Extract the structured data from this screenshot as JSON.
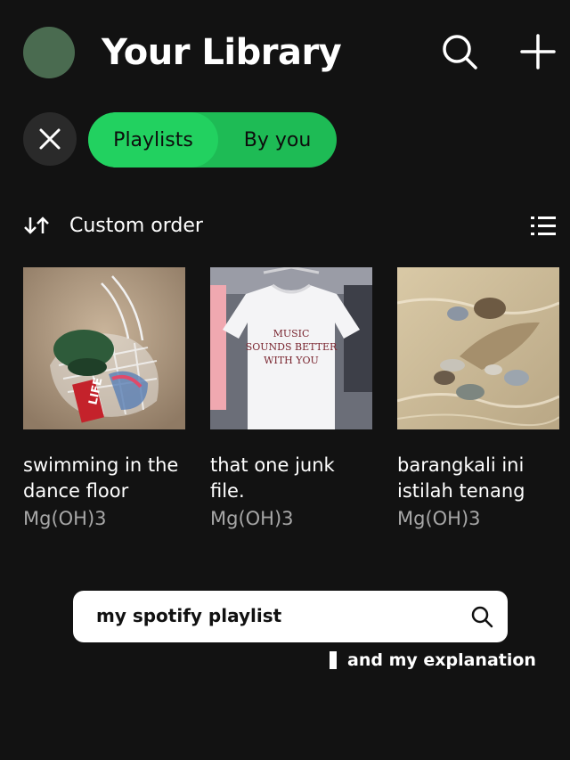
{
  "header": {
    "title": "Your Library",
    "search_icon": "search-icon",
    "add_icon": "plus-icon"
  },
  "filters": {
    "close_icon": "close-icon",
    "chips": [
      "Playlists",
      "By you"
    ],
    "selected": "Playlists"
  },
  "sort": {
    "icon": "sort-arrows-icon",
    "label": "Custom order",
    "view_icon": "list-view-icon"
  },
  "playlists": [
    {
      "title": "swimming in the dance floor",
      "owner": "Mg(OH)3"
    },
    {
      "title": "that one junk file.",
      "owner": "Mg(OH)3"
    },
    {
      "title": "barangkali ini istilah tenang",
      "owner": "Mg(OH)3"
    }
  ],
  "covers": {
    "shirt_text_line1": "MUSIC",
    "shirt_text_line2": "SOUNDS BETTER",
    "shirt_text_line3": "WITH YOU",
    "bag_label": "LIFE"
  },
  "overlay": {
    "search_text": "my spotify playlist",
    "caption": "and my explanation"
  },
  "colors": {
    "background": "#121212",
    "accent_green": "#1ed760",
    "subtext": "#a7a7a7"
  }
}
